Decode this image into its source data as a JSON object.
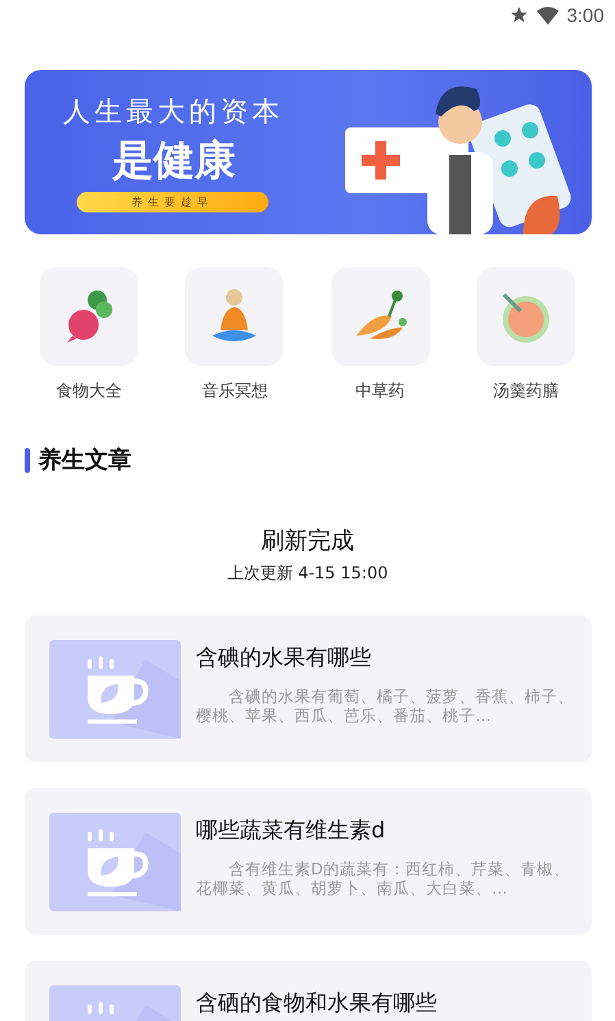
{
  "status_bar": {
    "time": "3:00"
  },
  "banner": {
    "headline": "人生最大的资本",
    "subline": "是健康",
    "tag": "养生要趁早"
  },
  "categories": [
    {
      "kind": "radish",
      "label": "食物大全"
    },
    {
      "kind": "meditation",
      "label": "音乐冥想"
    },
    {
      "kind": "herb",
      "label": "中草药"
    },
    {
      "kind": "soup",
      "label": "汤羹药膳"
    }
  ],
  "section_title": "养生文章",
  "refresh": {
    "status": "刷新完成",
    "updated": "上次更新 4-15 15:00"
  },
  "articles": [
    {
      "title": "含碘的水果有哪些",
      "summary": "　　含碘的水果有葡萄、橘子、菠萝、香蕉、柿子、樱桃、苹果、西瓜、芭乐、番茄、桃子…"
    },
    {
      "title": "哪些蔬菜有维生素d",
      "summary": "　　含有维生素D的蔬菜有：西红柿、芹菜、青椒、花椰菜、黄瓜、胡萝卜、南瓜、大白菜、…"
    },
    {
      "title": "含硒的食物和水果有哪些"
    }
  ]
}
